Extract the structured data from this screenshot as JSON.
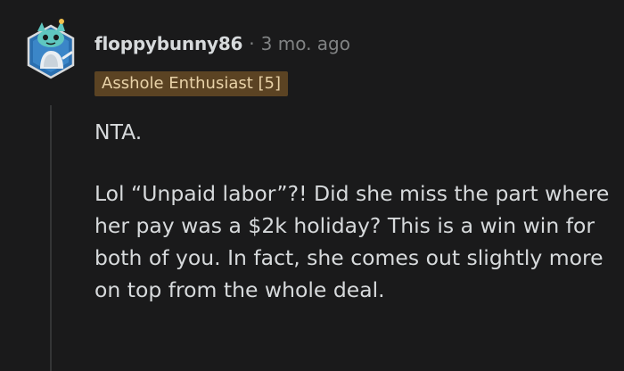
{
  "comment": {
    "username": "floppybunny86",
    "separator": "·",
    "timestamp": "3 mo. ago",
    "flair": "Asshole Enthusiast [5]",
    "avatar_icon": "snoo-avatar-icon",
    "paragraphs": [
      "NTA.",
      "Lol “Unpaid labor”?! Did she miss the part where her pay was a $2k holiday? This is a win win for both of you. In fact, she comes out slightly more on top from the whole deal."
    ]
  },
  "colors": {
    "background": "#1a1a1b",
    "text": "#d7dadc",
    "meta": "#818384",
    "flair_bg": "#5b4323",
    "flair_text": "#e8d2a8",
    "avatar_accent": "#3fb5b0"
  }
}
